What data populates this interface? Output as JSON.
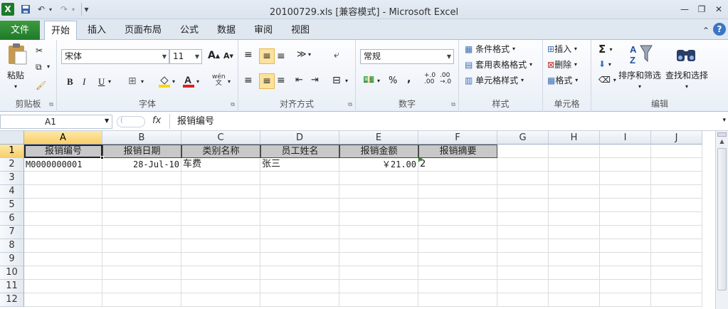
{
  "window": {
    "title": "20100729.xls  [兼容模式] - Microsoft Excel"
  },
  "quick_access": {
    "excel_icon": "excel-icon",
    "save_icon": "save-icon",
    "undo_icon": "undo-icon",
    "redo_icon": "redo-icon",
    "customize": "▾"
  },
  "tabs": [
    {
      "label": "文件"
    },
    {
      "label": "开始"
    },
    {
      "label": "插入"
    },
    {
      "label": "页面布局"
    },
    {
      "label": "公式"
    },
    {
      "label": "数据"
    },
    {
      "label": "审阅"
    },
    {
      "label": "视图"
    }
  ],
  "ribbon": {
    "clipboard": {
      "paste": "粘贴",
      "label": "剪贴板"
    },
    "font": {
      "name": "宋体",
      "size": "11",
      "bold": "B",
      "italic": "I",
      "underline": "U",
      "grow": "A",
      "shrink": "A",
      "label": "字体",
      "phonetic": "wén\n文"
    },
    "alignment": {
      "label": "对齐方式"
    },
    "number": {
      "format": "常规",
      "percent": "%",
      "comma": ",",
      "inc": "+.0\n.00",
      "dec": ".00\n→.0",
      "label": "数字"
    },
    "styles": {
      "conditional": "条件格式",
      "table": "套用表格格式",
      "cell": "单元格样式",
      "label": "样式"
    },
    "cells": {
      "insert": "插入",
      "delete": "删除",
      "format": "格式",
      "label": "单元格"
    },
    "editing": {
      "sort": "排序和筛选",
      "find": "查找和选择",
      "sum": "Σ",
      "label": "编辑"
    }
  },
  "formula_bar": {
    "name_box": "A1",
    "fx": "fx",
    "value": "报销编号"
  },
  "columns": [
    "A",
    "B",
    "C",
    "D",
    "E",
    "F",
    "G",
    "H",
    "I",
    "J"
  ],
  "rows": [
    "1",
    "2",
    "3",
    "4",
    "5",
    "6",
    "7",
    "8",
    "9",
    "10",
    "11",
    "12"
  ],
  "sheet": {
    "headers": [
      "报销编号",
      "报销日期",
      "类别名称",
      "员工姓名",
      "报销金额",
      "报销摘要"
    ],
    "row2": [
      "M0000000001",
      "28-Jul-10",
      "车费",
      "张三",
      "￥21.00",
      "2"
    ]
  }
}
